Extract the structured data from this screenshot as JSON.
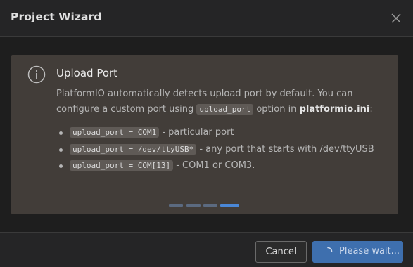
{
  "dialog": {
    "title": "Project Wizard",
    "close_icon": "close-icon"
  },
  "card": {
    "icon": "info-icon",
    "title": "Upload Port",
    "desc_part1": "PlatformIO automatically detects upload port by default. You can configure a custom port using ",
    "desc_code": "upload_port",
    "desc_part2": " option in ",
    "desc_file": "platformio.ini",
    "desc_part3": ":",
    "items": [
      {
        "code": "upload_port = COM1",
        "text": " - particular port"
      },
      {
        "code": "upload_port = /dev/ttyUSB*",
        "text": " - any port that starts with /dev/ttyUSB"
      },
      {
        "code": "upload_port = COM[13]",
        "text": " - COM1 or COM3."
      }
    ]
  },
  "pager": {
    "total": 4,
    "active_index": 3
  },
  "footer": {
    "cancel_label": "Cancel",
    "wait_label": "Please wait...",
    "wait_icon": "spinner-icon"
  },
  "colors": {
    "accent": "#4a87d6",
    "card_bg": "#423d39",
    "primary_button": "#3e6fae"
  }
}
